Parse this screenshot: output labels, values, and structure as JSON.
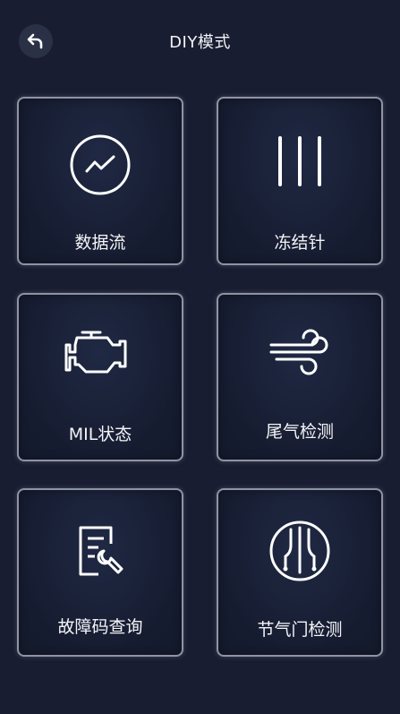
{
  "header": {
    "title": "DIY模式",
    "back_icon": "back-arrow-icon"
  },
  "tiles": [
    {
      "label": "数据流",
      "icon": "data-stream-icon"
    },
    {
      "label": "冻结针",
      "icon": "freeze-frame-icon"
    },
    {
      "label": "MIL状态",
      "icon": "engine-icon"
    },
    {
      "label": "尾气检测",
      "icon": "wind-icon"
    },
    {
      "label": "故障码查询",
      "icon": "report-wrench-icon"
    },
    {
      "label": "节气门检测",
      "icon": "throttle-icon"
    }
  ],
  "colors": {
    "background": "#181d31",
    "tile_border": "#8f93a4",
    "text": "#f4f5f8"
  }
}
